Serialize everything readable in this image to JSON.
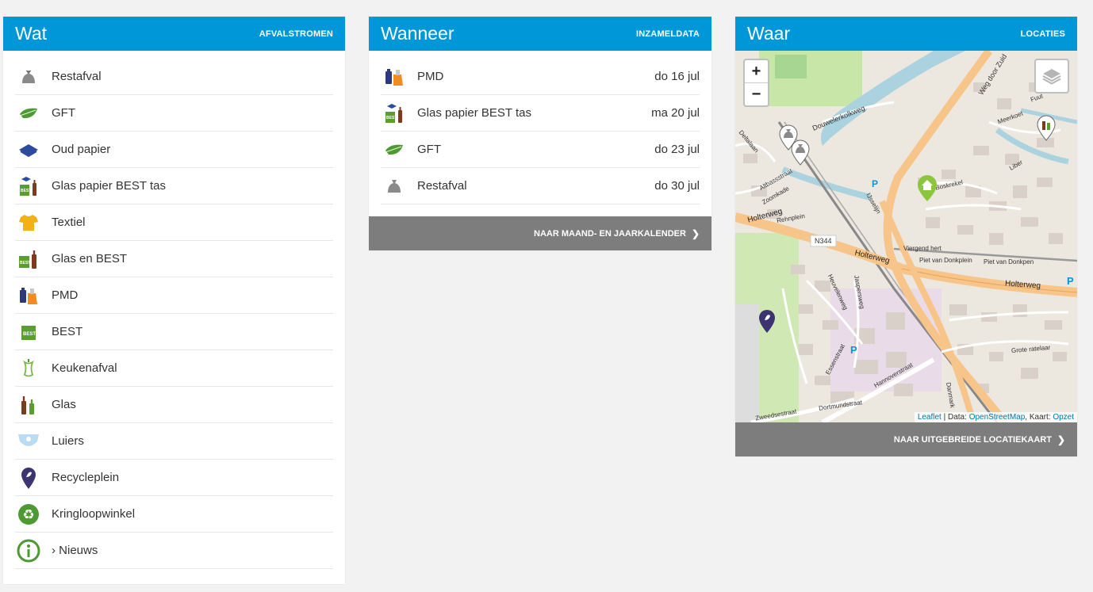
{
  "wat": {
    "title": "Wat",
    "subtitle": "AFVALSTROMEN",
    "items": [
      {
        "label": "Restafval",
        "icon": "restafval-bag-icon"
      },
      {
        "label": "GFT",
        "icon": "gft-leaf-icon"
      },
      {
        "label": "Oud papier",
        "icon": "paper-icon"
      },
      {
        "label": "Glas papier BEST tas",
        "icon": "glas-papier-best-icon"
      },
      {
        "label": "Textiel",
        "icon": "tshirt-icon"
      },
      {
        "label": "Glas en BEST",
        "icon": "glas-best-icon"
      },
      {
        "label": "PMD",
        "icon": "pmd-icon"
      },
      {
        "label": "BEST",
        "icon": "best-bag-icon"
      },
      {
        "label": "Keukenafval",
        "icon": "apple-core-icon"
      },
      {
        "label": "Glas",
        "icon": "bottles-icon"
      },
      {
        "label": "Luiers",
        "icon": "diaper-icon"
      },
      {
        "label": "Recycleplein",
        "icon": "map-pin-icon"
      },
      {
        "label": "Kringloopwinkel",
        "icon": "recycle-icon"
      },
      {
        "label": "› Nieuws",
        "icon": "info-icon"
      }
    ]
  },
  "wanneer": {
    "title": "Wanneer",
    "subtitle": "INZAMELDATA",
    "items": [
      {
        "label": "PMD",
        "date": "do 16 jul",
        "icon": "pmd-icon"
      },
      {
        "label": "Glas papier BEST tas",
        "date": "ma 20 jul",
        "icon": "glas-papier-best-icon"
      },
      {
        "label": "GFT",
        "date": "do 23 jul",
        "icon": "gft-leaf-icon"
      },
      {
        "label": "Restafval",
        "date": "do 30 jul",
        "icon": "restafval-bag-icon"
      }
    ],
    "footer": "NAAR MAAND- EN JAARKALENDER"
  },
  "waar": {
    "title": "Waar",
    "subtitle": "LOCATIES",
    "footer": "NAAR UITGEBREIDE LOCATIEKAART",
    "zoom_in": "+",
    "zoom_out": "−",
    "attribution": {
      "leaflet": "Leaflet",
      "sep1": " | Data: ",
      "osm": "OpenStreetMap",
      "sep2": ", Kaart: ",
      "opzet": "Opzet"
    },
    "map_labels": [
      "Weg door Zuid",
      "Douwelerkolkweg",
      "Holterweg",
      "Holterweg",
      "Holterweg",
      "N344",
      "Piet van Donkplein",
      "Piet van Donkpen",
      "Essenstraat",
      "Hannoverstraat",
      "Dortmundstraat",
      "Zweedsestraat",
      "Heuvelenweg",
      "Jaspersweg",
      "Boskrekel",
      "Liber",
      "Meerkoet",
      "Fuut",
      "Viergend hert",
      "Grote ratelaar",
      "Altbassstraat",
      "Zoomkade",
      "Deltalaan",
      "IJsselijn",
      "Rehnplein",
      "Danmark"
    ]
  },
  "colors": {
    "header_blue": "#0097d9",
    "footer_grey": "#7d7d7d",
    "pin_purple": "#3b3470",
    "pin_green": "#8cc63f"
  }
}
